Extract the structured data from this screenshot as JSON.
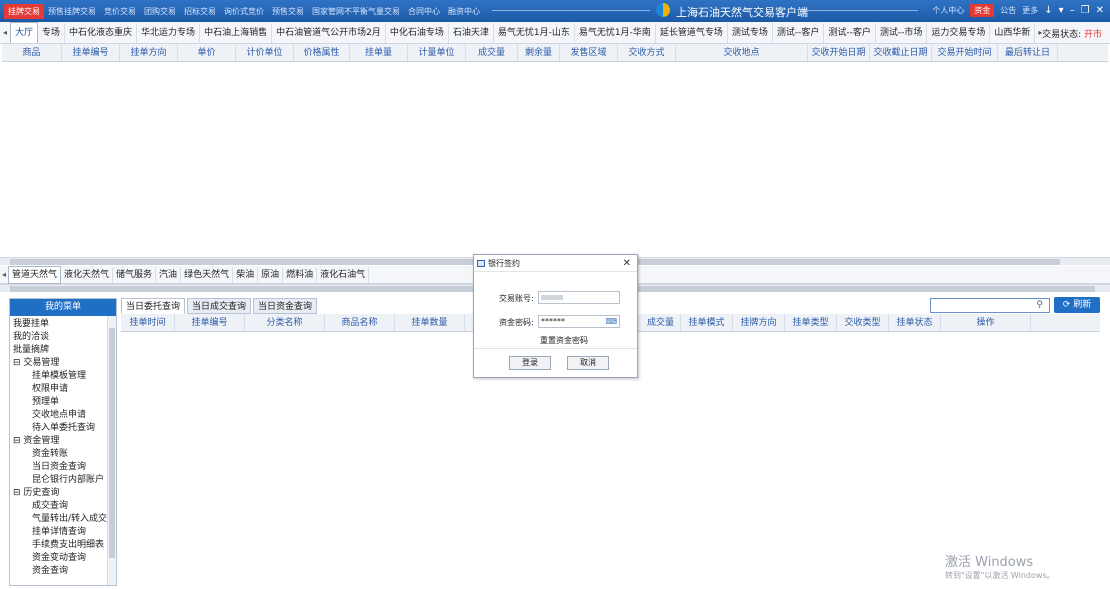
{
  "titlebar": {
    "menu": [
      "挂牌交易",
      "预售挂牌交易",
      "竞价交易",
      "团购交易",
      "招标交易",
      "询价式竞价",
      "预售交易",
      "国家管网不平衡气量交易",
      "合同中心",
      "融资中心"
    ],
    "title": "上海石油天然气交易客户端",
    "right": {
      "personal": "个人中心",
      "funds": "资金",
      "announcement": "公告",
      "more": "更多"
    }
  },
  "tabs": [
    "大厅",
    "专场",
    "中石化液态重庆",
    "华北运力专场",
    "中石油上海销售",
    "中石油管道气公开市场2月",
    "中化石油专场",
    "石油天津",
    "易气无忧1月-山东",
    "易气无忧1月-华南",
    "延长管道气专场",
    "测试专场",
    "测试--客户",
    "测试--客户",
    "测试--市场",
    "运力交易专场",
    "山西华新"
  ],
  "trade_status": {
    "label": "交易状态:",
    "value": "开市"
  },
  "top_columns": [
    "商品",
    "挂单编号",
    "挂单方向",
    "单价",
    "计价单位",
    "价格属性",
    "挂单量",
    "计量单位",
    "成交量",
    "剩余量",
    "发售区域",
    "交收方式",
    "交收地点",
    "交收开始日期",
    "交收截止日期",
    "交易开始时间",
    "最后转让日"
  ],
  "product_tabs": [
    "管道天然气",
    "液化天然气",
    "储气服务",
    "汽油",
    "绿色天然气",
    "柴油",
    "原油",
    "燃料油",
    "液化石油气"
  ],
  "left_menu": {
    "title": "我的菜单",
    "items": [
      "我要挂单",
      "我的洽谈",
      "批量摘牌",
      "交易管理",
      "挂单模板管理",
      "权限申请",
      "预理单",
      "交收地点申请",
      "待入单委托查询",
      "资金管理",
      "资金转账",
      "当日资金查询",
      "昆仑银行内部账户",
      "历史查询",
      "成交查询",
      "气量转出/转入成交",
      "挂单详情查询",
      "手续费支出明细表",
      "资金变动查询",
      "资金查询"
    ]
  },
  "query_tabs": [
    "当日委托查询",
    "当日成交查询",
    "当日资金查询"
  ],
  "bottom_columns_left": [
    "挂单时间",
    "挂单编号",
    "分类名称",
    "商品名称",
    "挂单数量"
  ],
  "bottom_columns_right": [
    "成交量",
    "挂单模式",
    "挂牌方向",
    "挂单类型",
    "交收类型",
    "挂单状态",
    "操作"
  ],
  "search": {
    "icon": "search-icon"
  },
  "refresh_label": "刷新",
  "dialog": {
    "title": "银行签约",
    "account_label": "交易账号:",
    "password_label": "资金密码:",
    "password_value": "******",
    "reset_link": "重置资金密码",
    "login": "登录",
    "cancel": "取消"
  },
  "watermark": {
    "line1": "激活 Windows",
    "line2": "转到\"设置\"以激活 Windows。"
  }
}
